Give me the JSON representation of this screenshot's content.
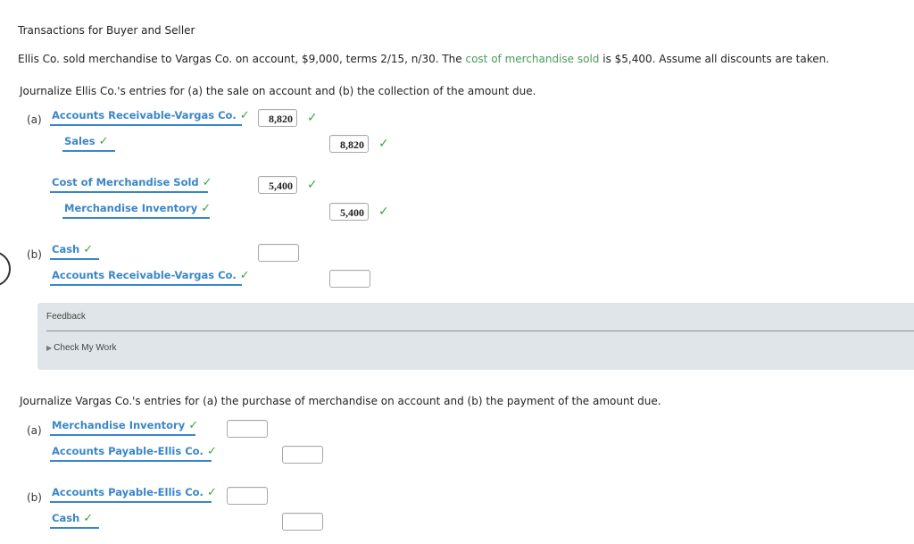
{
  "title": "Transactions for Buyer and Seller",
  "problem": {
    "before": "Ellis Co. sold merchandise to Vargas Co. on account, $9,000, terms 2/15, n/30. The ",
    "highlight": "cost of merchandise sold",
    "after": " is $5,400. Assume all discounts are taken."
  },
  "seller": {
    "instruction": "Journalize Ellis Co.'s entries for (a) the sale on account and (b) the collection of the amount due.",
    "part_a_label": "(a)",
    "part_b_label": "(b)",
    "entries": [
      {
        "account": "Accounts Receivable-Vargas Co.",
        "debit": "8,820",
        "credit": ""
      },
      {
        "account": "Sales",
        "debit": "",
        "credit": "8,820"
      },
      {
        "account": "Cost of Merchandise Sold",
        "debit": "5,400",
        "credit": ""
      },
      {
        "account": "Merchandise Inventory",
        "debit": "",
        "credit": "5,400"
      },
      {
        "account": "Cash",
        "debit": "",
        "credit": ""
      },
      {
        "account": "Accounts Receivable-Vargas Co.",
        "debit": "",
        "credit": ""
      }
    ]
  },
  "feedback": {
    "label": "Feedback",
    "check_my_work": "Check My Work"
  },
  "buyer": {
    "instruction": "Journalize Vargas Co.'s entries for (a) the purchase of merchandise on account and (b) the payment of the amount due.",
    "part_a_label": "(a)",
    "part_b_label": "(b)",
    "entries": [
      {
        "account": "Merchandise Inventory",
        "debit": "",
        "credit": ""
      },
      {
        "account": "Accounts Payable-Ellis Co.",
        "debit": "",
        "credit": ""
      },
      {
        "account": "Accounts Payable-Ellis Co.",
        "debit": "",
        "credit": ""
      },
      {
        "account": "Cash",
        "debit": "",
        "credit": ""
      }
    ]
  },
  "icons": {
    "check": "✓",
    "triangle": "▶"
  },
  "colors": {
    "account_link": "#3a86c8",
    "check": "#3aa53a",
    "highlight": "#4a9a5a",
    "feedback_bg": "#dfe5e8"
  }
}
